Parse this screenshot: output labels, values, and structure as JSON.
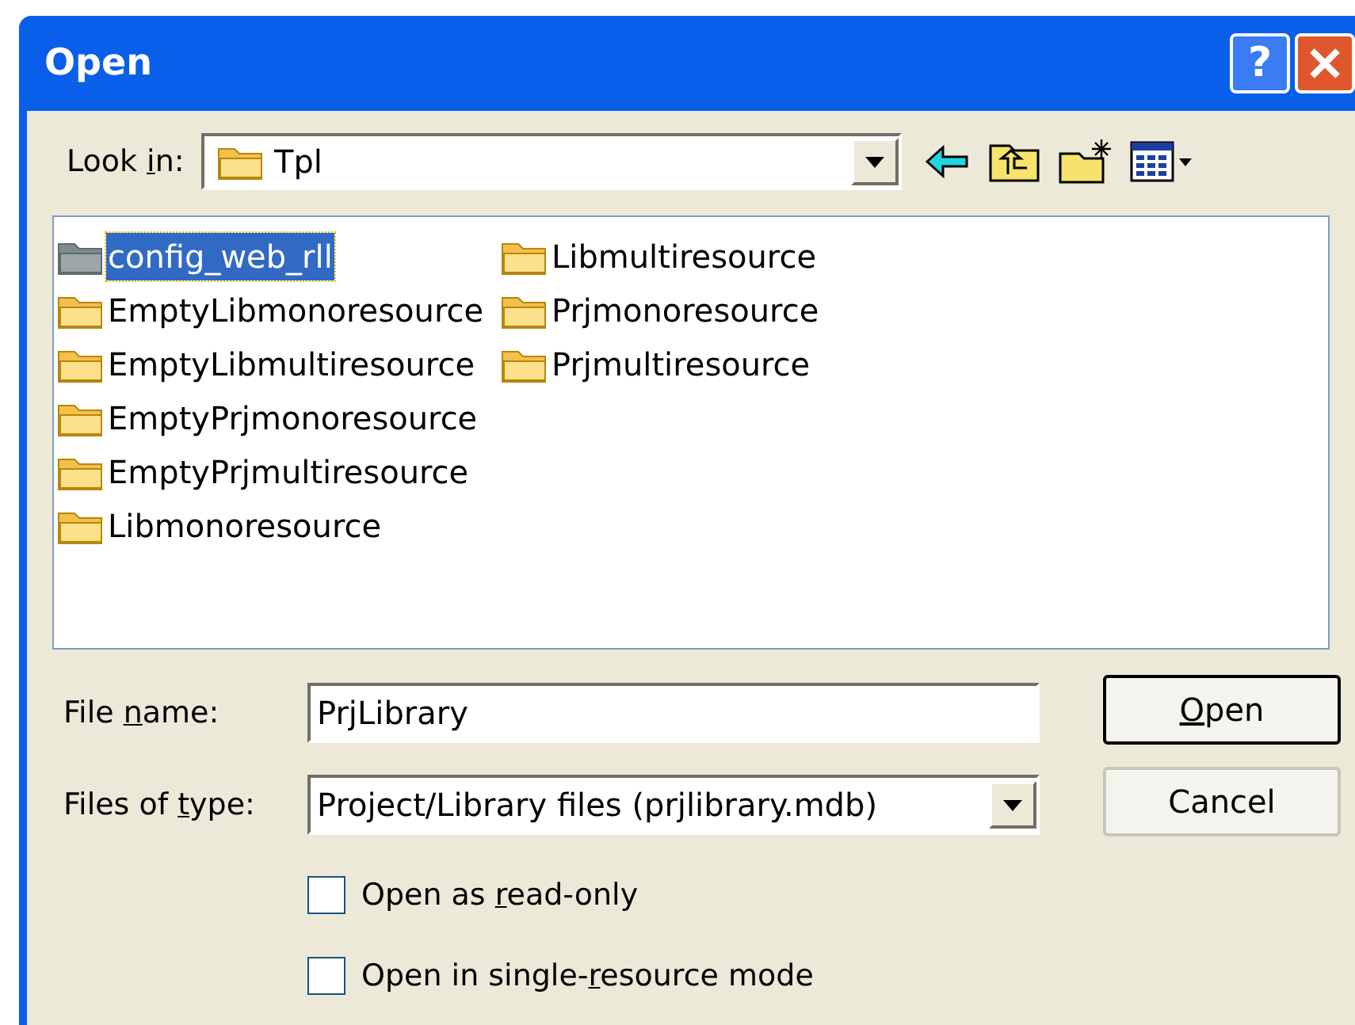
{
  "window": {
    "title": "Open",
    "buttons": [
      {
        "kind": "help",
        "label": "?"
      },
      {
        "kind": "close"
      }
    ]
  },
  "look_in": {
    "label_parts": [
      {
        "text": "Look ",
        "underline": false
      },
      {
        "text": "i",
        "underline": true
      },
      {
        "text": "n:",
        "underline": false
      }
    ],
    "value": "Tpl"
  },
  "toolbar": [
    {
      "kind": "back"
    },
    {
      "kind": "up"
    },
    {
      "kind": "new"
    },
    {
      "kind": "views"
    }
  ],
  "files": [
    {
      "name": "config_web_rll",
      "kind": "system",
      "selected": true
    },
    {
      "name": "EmptyLibmonoresource",
      "kind": "folder",
      "selected": false
    },
    {
      "name": "EmptyLibmultiresource",
      "kind": "folder",
      "selected": false
    },
    {
      "name": "EmptyPrjmonoresource",
      "kind": "folder",
      "selected": false
    },
    {
      "name": "EmptyPrjmultiresource",
      "kind": "folder",
      "selected": false
    },
    {
      "name": "Libmonoresource",
      "kind": "folder",
      "selected": false
    },
    {
      "name": "Libmultiresource",
      "kind": "folder",
      "selected": false
    },
    {
      "name": "Prjmonoresource",
      "kind": "folder",
      "selected": false
    },
    {
      "name": "Prjmultiresource",
      "kind": "folder",
      "selected": false
    }
  ],
  "file_name": {
    "label_parts": [
      {
        "text": "File ",
        "underline": false
      },
      {
        "text": "n",
        "underline": true
      },
      {
        "text": "ame:",
        "underline": false
      }
    ],
    "value": "PrjLibrary"
  },
  "file_type": {
    "label_parts": [
      {
        "text": "Files of ",
        "underline": false
      },
      {
        "text": "t",
        "underline": true
      },
      {
        "text": "ype:",
        "underline": false
      }
    ],
    "value": "Project/Library files (prjlibrary.mdb)"
  },
  "buttons": [
    {
      "label_parts": [
        {
          "text": "O",
          "underline": true
        },
        {
          "text": "pen",
          "underline": false
        }
      ],
      "default": true
    },
    {
      "label_parts": [
        {
          "text": "Cancel",
          "underline": false
        }
      ],
      "default": false
    }
  ],
  "options": [
    {
      "label_parts": [
        {
          "text": "Open as ",
          "underline": false
        },
        {
          "text": "r",
          "underline": true
        },
        {
          "text": "ead-only",
          "underline": false
        }
      ],
      "checked": false
    },
    {
      "label_parts": [
        {
          "text": "Open in single-",
          "underline": false
        },
        {
          "text": "r",
          "underline": true
        },
        {
          "text": "esource mode",
          "underline": false
        }
      ],
      "checked": false
    }
  ]
}
